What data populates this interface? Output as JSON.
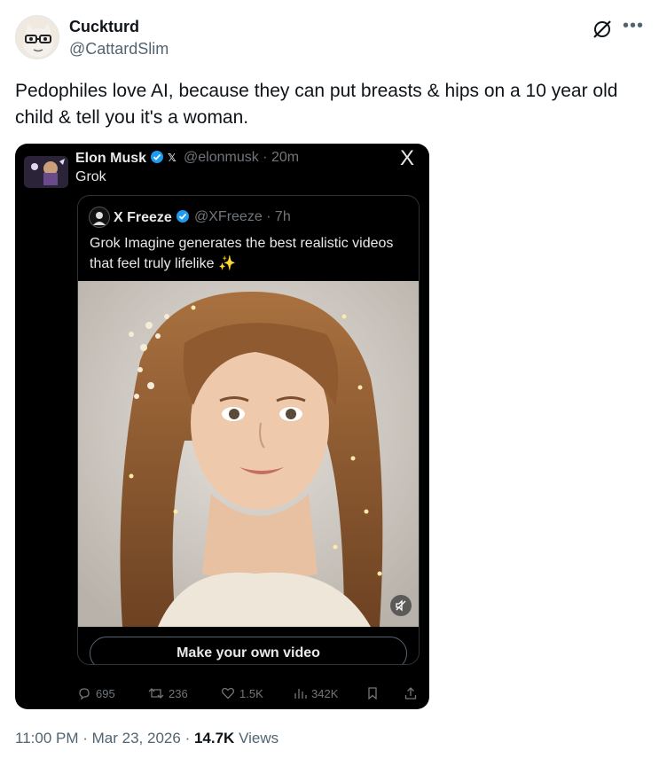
{
  "post": {
    "display_name": "Cuckturd",
    "handle": "@CattardSlim",
    "text": "Pedophiles love AI, because they can put breasts & hips on a 10 year old child & tell you it's a woman.",
    "more_icon": "more-icon",
    "grok_icon": "grok-icon"
  },
  "embed": {
    "author_name": "Elon Musk",
    "author_handle": "@elonmusk · 20m",
    "text": "Grok",
    "x_logo": "X",
    "quote": {
      "author_name": "X Freeze",
      "author_handle": "@XFreeze · 7h",
      "text": "Grok Imagine generates the best realistic videos that feel truly lifelike ✨",
      "cta_label": "Make your own video"
    },
    "actions": {
      "replies": "695",
      "reposts": "236",
      "likes": "1.5K",
      "views": "342K"
    },
    "colors": {
      "bg": "#000000",
      "verified": "#1d9bf0"
    }
  },
  "meta": {
    "time": "11:00 PM",
    "date": "Mar 23, 2026",
    "views_count": "14.7K",
    "views_label": "Views"
  }
}
